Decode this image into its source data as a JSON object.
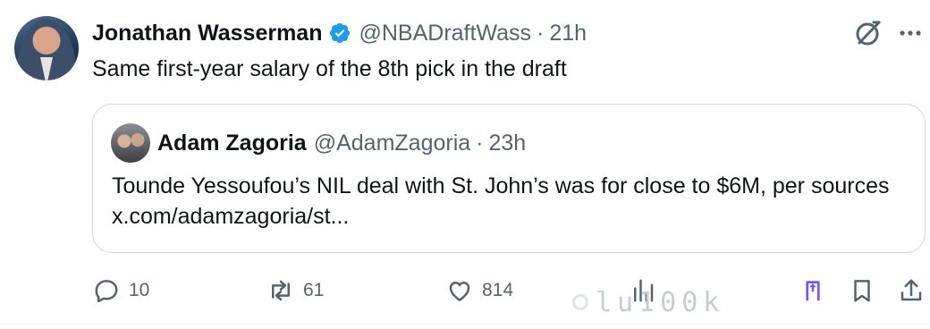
{
  "tweet": {
    "author_name": "Jonathan Wasserman",
    "handle": "@NBADraftWass",
    "separator": "·",
    "time": "21h",
    "verified": true,
    "text": "Same first-year salary of the 8th pick in the draft"
  },
  "quote": {
    "author_name": "Adam Zagoria",
    "handle": "@AdamZagoria",
    "separator": "·",
    "time": "23h",
    "text": "Tounde Yessoufou’s NIL deal with St. John’s was for close to $6M, per sources x.com/adamzagoria/st..."
  },
  "actions": {
    "replies": "10",
    "reposts": "61",
    "likes": "814"
  },
  "watermark": "lu100k",
  "colors": {
    "verified_blue": "#1d9bf0",
    "text_primary": "#0f1419",
    "text_secondary": "#536471",
    "border": "#cfd9de",
    "highlight_purple": "#7856ff"
  },
  "icons": [
    "grok-icon",
    "more-icon",
    "verified-badge-icon",
    "reply-icon",
    "repost-icon",
    "like-icon",
    "views-icon",
    "bookmark-icon",
    "share-icon"
  ]
}
